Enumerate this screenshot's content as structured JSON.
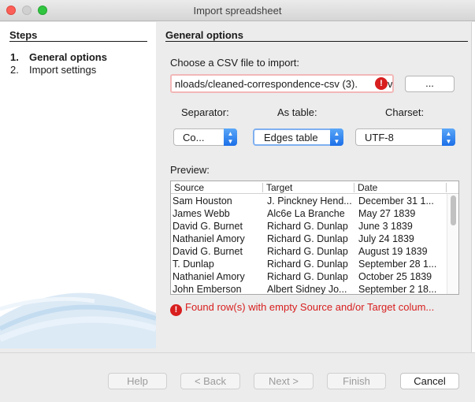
{
  "window": {
    "title": "Import spreadsheet"
  },
  "steps": {
    "heading": "Steps",
    "items": [
      {
        "num": "1.",
        "label": "General options"
      },
      {
        "num": "2.",
        "label": "Import settings"
      }
    ]
  },
  "main": {
    "heading": "General options",
    "csv_label": "Choose a CSV file to import:",
    "file_path": "nloads/cleaned-correspondence-csv (3).",
    "file_tail": "v",
    "browse_label": "...",
    "separator_label": "Separator:",
    "separator_value": "Co...",
    "table_label": "As table:",
    "table_value": "Edges table",
    "charset_label": "Charset:",
    "charset_value": "UTF-8",
    "preview_label": "Preview:",
    "error_text": "Found row(s) with empty Source and/or Target colum..."
  },
  "preview": {
    "columns": [
      "Source",
      "Target",
      "Date"
    ],
    "rows": [
      [
        "Sam Houston",
        "J. Pinckney Hend...",
        "December 31 1..."
      ],
      [
        "James Webb",
        "Alc6e La Branche",
        "May 27 1839"
      ],
      [
        "David G. Burnet",
        "Richard G. Dunlap",
        "June 3 1839"
      ],
      [
        "Nathaniel Amory",
        "Richard G. Dunlap",
        "July 24 1839"
      ],
      [
        "David G. Burnet",
        "Richard G. Dunlap",
        "August 19 1839"
      ],
      [
        "T. Dunlap",
        "Richard G. Dunlap",
        "September 28 1..."
      ],
      [
        "Nathaniel Amory",
        "Richard G. Dunlap",
        "October 25 1839"
      ],
      [
        "John Emberson",
        "Albert Sidney Jo...",
        "September 2 18..."
      ]
    ]
  },
  "buttons": {
    "help": "Help",
    "back": "< Back",
    "next": "Next >",
    "finish": "Finish",
    "cancel": "Cancel"
  }
}
